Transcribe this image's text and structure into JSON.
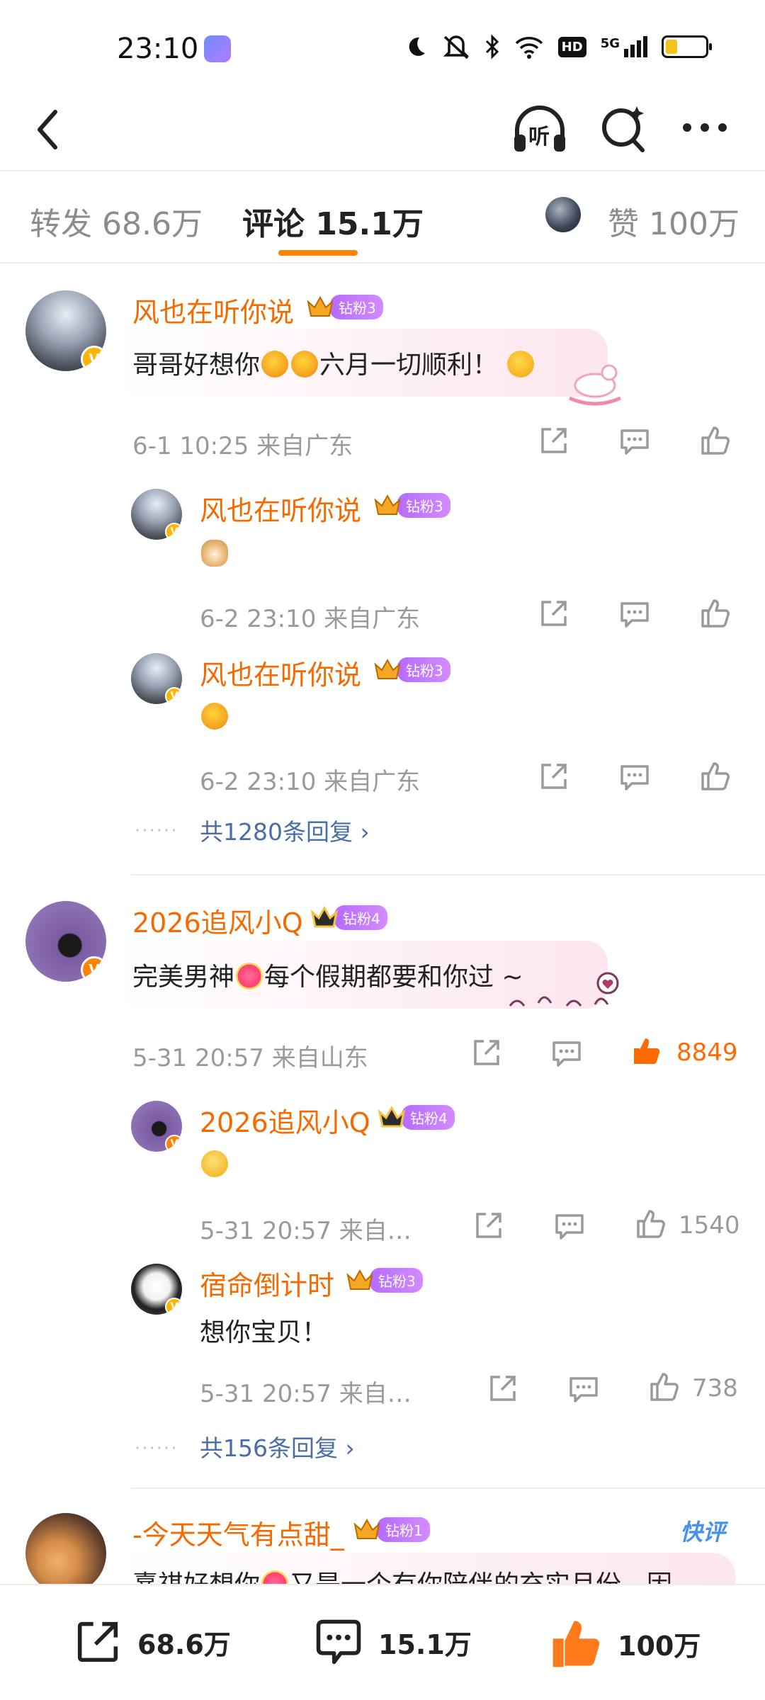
{
  "status_bar": {
    "time": "23:10",
    "icons": [
      "moon-icon",
      "mute-icon",
      "bluetooth-icon",
      "wifi-icon",
      "hd-icon",
      "5g-signal-icon",
      "battery-icon"
    ],
    "hd": "HD",
    "network": "5G"
  },
  "nav": {
    "listen_label": "听"
  },
  "tabs": [
    {
      "label": "转发 68.6万"
    },
    {
      "label": "评论 15.1万"
    },
    {
      "label": "赞 100万"
    }
  ],
  "accent_color": "#ff8200",
  "comments": [
    {
      "user": "风也在听你说",
      "badge": "钻粉3",
      "text_before": "哥哥好想你",
      "text_after": "六月一切顺利！",
      "meta": "6-1 10:25  来自广东",
      "replies": [
        {
          "user": "风也在听你说",
          "badge": "钻粉3",
          "meta": "6-2 23:10  来自广东"
        },
        {
          "user": "风也在听你说",
          "badge": "钻粉3",
          "meta": "6-2 23:10  来自广东"
        }
      ],
      "more": "共1280条回复 ›"
    },
    {
      "user": "2026追风小Q",
      "badge": "钻粉4",
      "text_before": "完美男神",
      "text_after": "每个假期都要和你过 ~",
      "meta": "5-31 20:57  来自山东",
      "likes": "8849",
      "replies": [
        {
          "user": "2026追风小Q",
          "badge": "钻粉4",
          "meta": "5-31 20:57  来自…",
          "likes": "1540"
        },
        {
          "user": "宿命倒计时",
          "badge": "钻粉3",
          "text": "想你宝贝！",
          "meta": "5-31 20:57  来自…",
          "likes": "738"
        }
      ],
      "more": "共156条回复 ›"
    },
    {
      "user": "-今天天气有点甜_",
      "badge": "钻粉1",
      "text_before": "熹祺好想你",
      "text_after": "又是一个有你陪伴的充实月份，因",
      "tag": "快评"
    }
  ],
  "bottom_bar": {
    "repost": "68.6万",
    "comment": "15.1万",
    "like": "100万"
  }
}
